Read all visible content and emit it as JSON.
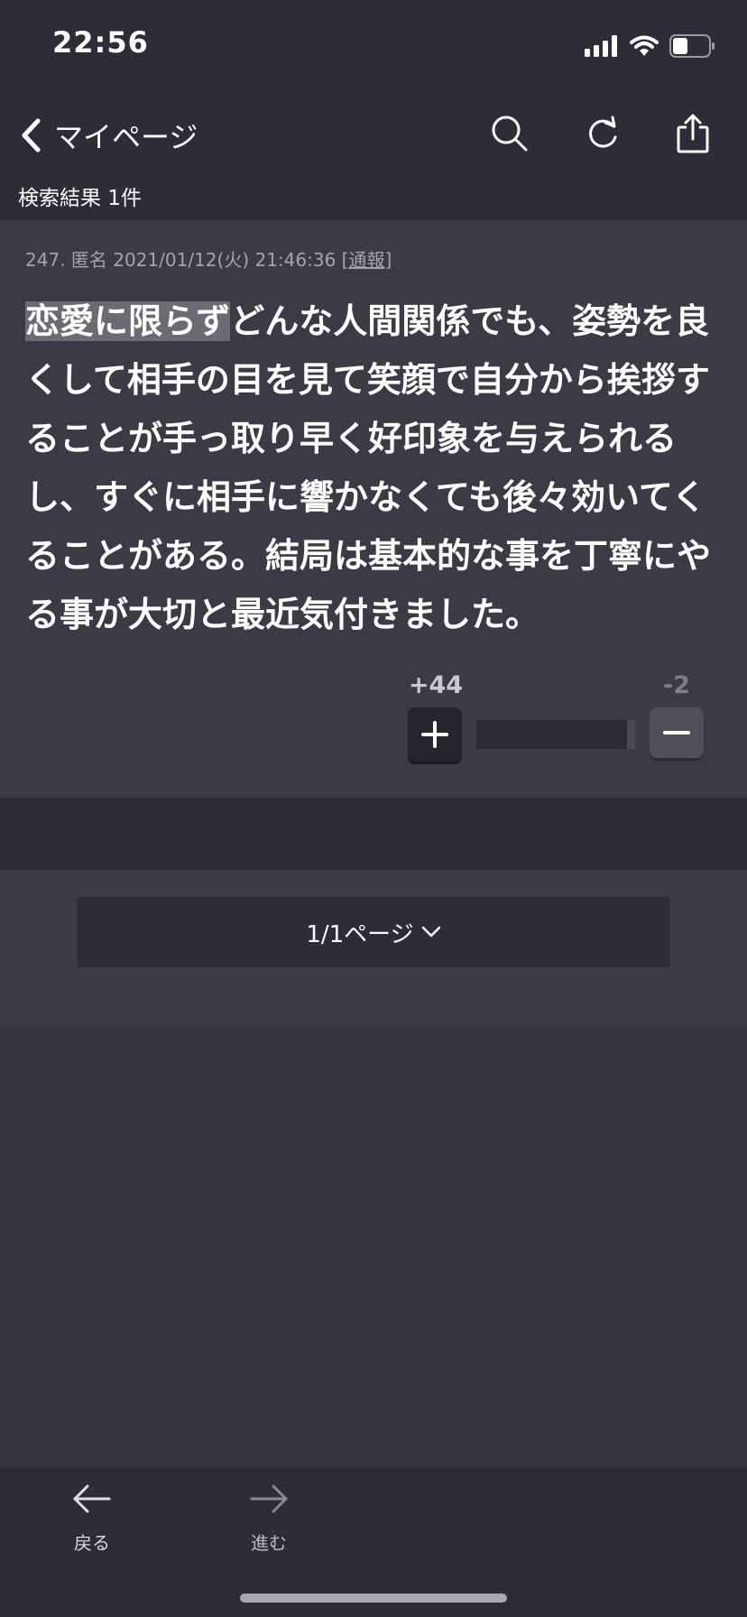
{
  "status_bar": {
    "time": "22:56",
    "battery_percent": 40
  },
  "nav": {
    "back_label": "マイページ",
    "icons": [
      "search-icon",
      "refresh-icon",
      "share-icon"
    ]
  },
  "search": {
    "result_count_text": "検索結果 1件"
  },
  "post": {
    "number": "247.",
    "author": "匿名",
    "datetime": "2021/01/12(火) 21:46:36",
    "report_label": "通報",
    "highlight_text": "恋愛に限らず",
    "body_rest": "どんな人間関係でも、姿勢を良くして相手の目を見て笑顔で自分から挨拶することが手っ取り早く好印象を与えられるし、すぐに相手に響かなくても後々効いてくることがある。結局は基本的な事を丁寧にやる事が大切と最近気付きました。",
    "votes": {
      "plus": "+44",
      "minus": "-2",
      "minus_fraction": 0.05
    }
  },
  "pagination": {
    "label": "1/1ページ"
  },
  "toolbar": {
    "back_label": "戻る",
    "forward_label": "進む"
  },
  "colors": {
    "background": "#36363f",
    "bar": "#2d2d37",
    "card": "#3b3b45",
    "highlight": "#6b6b74"
  }
}
